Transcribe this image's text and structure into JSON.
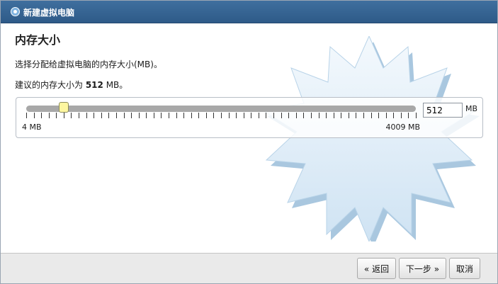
{
  "window": {
    "title": "新建虚拟电脑",
    "title_icon": "vbox-logo-icon"
  },
  "page": {
    "heading": "内存大小",
    "description": "选择分配给虚拟电脑的内存大小(MB)。",
    "recommendation_prefix": "建议的内存大小为 ",
    "recommendation_value": "512",
    "recommendation_suffix": " MB。"
  },
  "memory": {
    "min_label": "4 MB",
    "max_label": "4009 MB",
    "min_value": 4,
    "max_value": 4009,
    "value": "512",
    "unit": "MB",
    "slider_fraction": 0.096
  },
  "buttons": {
    "back": "« 返回",
    "next": "下一步 »",
    "cancel": "取消"
  },
  "colors": {
    "titlebar": "#2e5a88",
    "slider_thumb": "#fdf6a0",
    "star_fill": "#d9ebf8"
  }
}
